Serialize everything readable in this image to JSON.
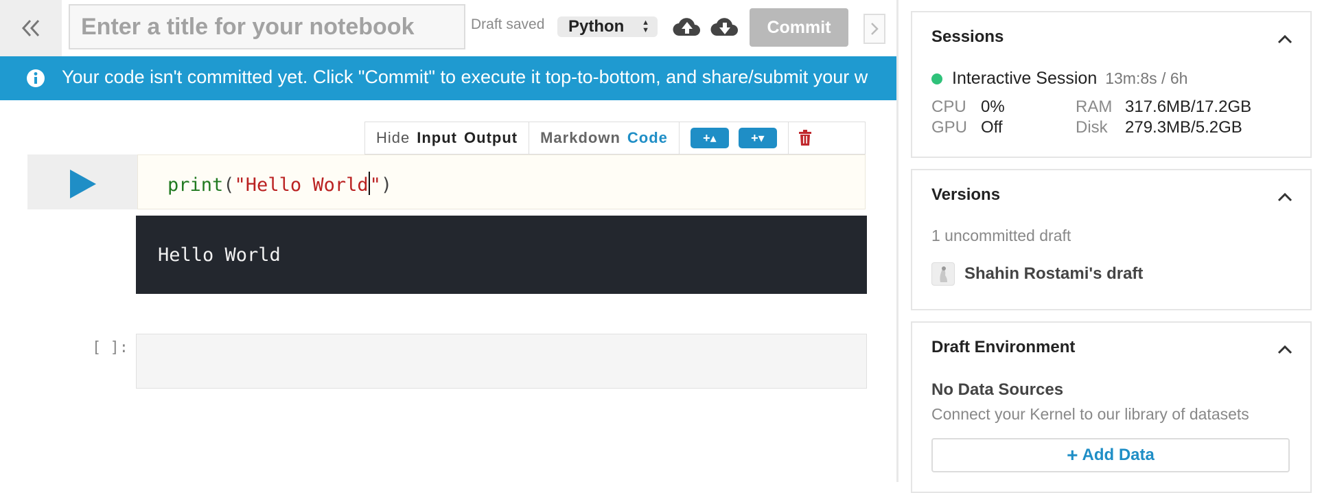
{
  "toolbar": {
    "title_placeholder": "Enter a title for your notebook",
    "draft_status": "Draft saved",
    "language": "Python",
    "commit_label": "Commit"
  },
  "banner": {
    "text": "Your code isn't committed yet. Click \"Commit\" to execute it top-to-bottom, and share/submit your w"
  },
  "cell_toolbar": {
    "hide": "Hide",
    "input": "Input",
    "output": "Output",
    "markdown": "Markdown",
    "code": "Code"
  },
  "cell": {
    "code_fn": "print",
    "code_open": "(",
    "code_str_before_cursor": "\"Hello World",
    "code_str_after_cursor": "\"",
    "code_close": ")",
    "output": "Hello World"
  },
  "empty_cell": {
    "prompt": "[ ]:"
  },
  "sessions": {
    "title": "Sessions",
    "session_name": "Interactive Session",
    "session_time": "13m:8s / 6h",
    "cpu_label": "CPU",
    "cpu_value": "0%",
    "gpu_label": "GPU",
    "gpu_value": "Off",
    "ram_label": "RAM",
    "ram_value": "317.6MB/17.2GB",
    "disk_label": "Disk",
    "disk_value": "279.3MB/5.2GB",
    "status_color": "#2fc27a"
  },
  "versions": {
    "title": "Versions",
    "summary": "1 uncommitted draft",
    "draft_owner": "Shahin Rostami's draft"
  },
  "environment": {
    "title": "Draft Environment",
    "heading": "No Data Sources",
    "description": "Connect your Kernel to our library of datasets",
    "add_label": "Add Data"
  },
  "colors": {
    "accent": "#1f8ec6",
    "banner": "#1f9ad0",
    "output_bg": "#23272e"
  }
}
